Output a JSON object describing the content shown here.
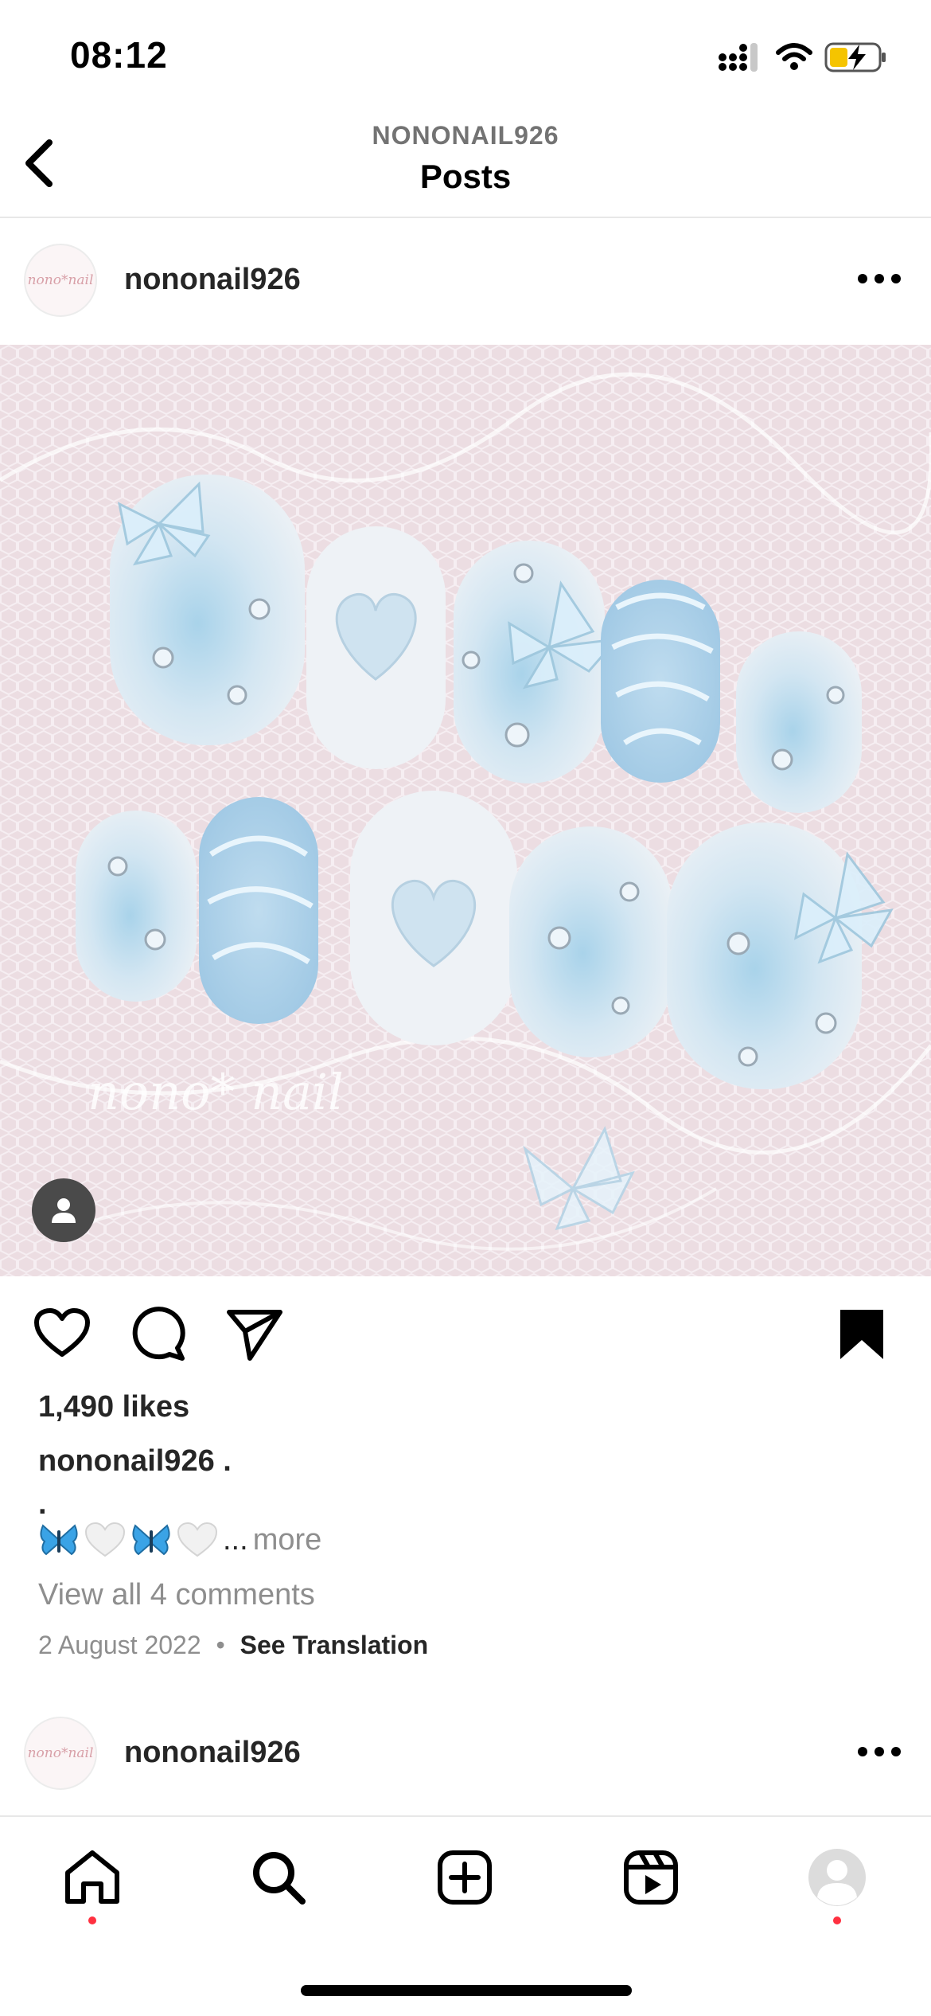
{
  "status_bar": {
    "time": "08:12",
    "signal_icon": "signal-icon",
    "wifi_icon": "wifi-icon",
    "battery_icon": "battery-charging-icon",
    "battery_color": "#f5c400"
  },
  "header": {
    "username": "NONONAIL926",
    "title": "Posts",
    "back_icon": "chevron-left-icon"
  },
  "post": {
    "username": "nononail926",
    "avatar_text": "nono*nail",
    "image_watermark": "nono* nail",
    "likes": "1,490 likes",
    "caption_username": "nononail926",
    "caption_first_line": ".",
    "caption_second_line": ".",
    "caption_emojis": [
      "butterfly",
      "white-heart",
      "butterfly",
      "white-heart"
    ],
    "caption_ellipsis": "...",
    "caption_more": "more",
    "view_comments": "View all 4 comments",
    "date": "2 August 2022",
    "date_separator": "•",
    "see_translation": "See Translation",
    "saved": true
  },
  "next_post": {
    "username": "nononail926",
    "avatar_text": "nono*nail"
  },
  "bottom_nav": {
    "items": [
      "home",
      "search",
      "create",
      "reels",
      "profile"
    ],
    "notification_dot_color": "#ff3040"
  },
  "colors": {
    "text": "#262626",
    "muted": "#8e8e8e",
    "divider": "#e8e8e8",
    "nail_blue": "#a9d3ea"
  }
}
